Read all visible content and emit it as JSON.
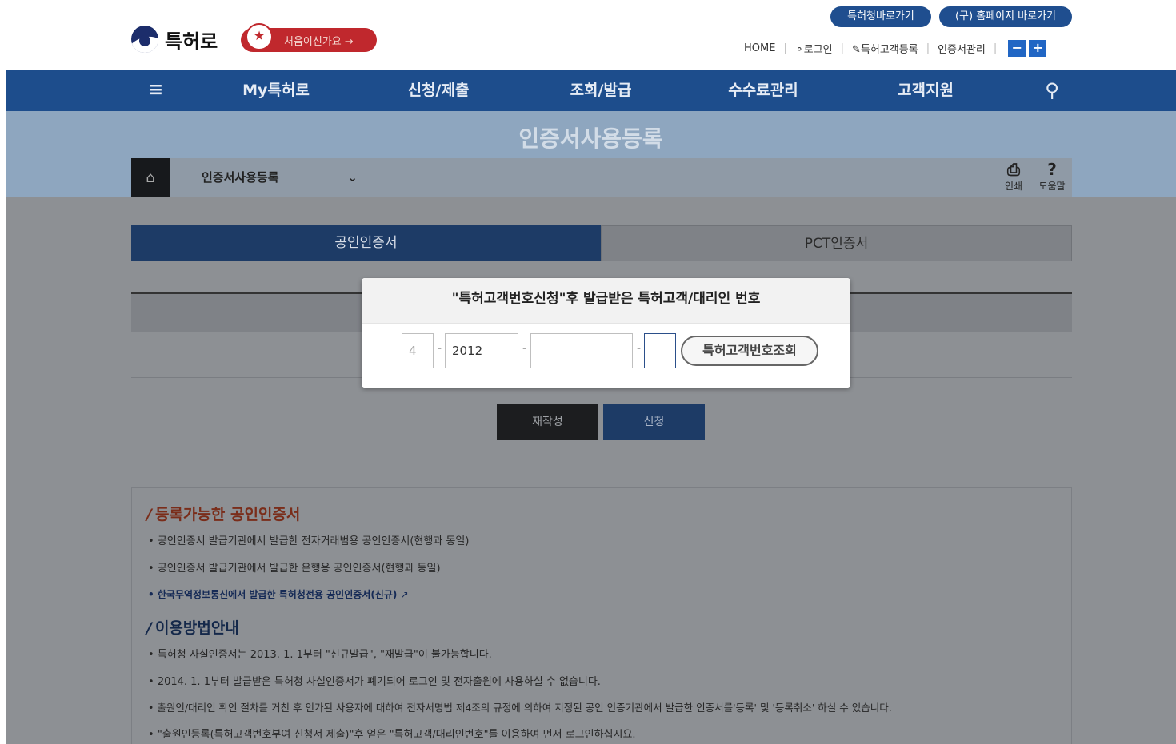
{
  "header": {
    "logo_text": "특허로",
    "newbie_label": "처음이신가요 →",
    "quick_links": [
      "특허청바로가기",
      "(구) 홈페이지 바로가기"
    ],
    "top_nav": [
      "HOME",
      "로그인",
      "특허고객등록",
      "인증서관리"
    ],
    "zoom_out": "−",
    "zoom_in": "+"
  },
  "main_nav": [
    "My특허로",
    "신청/제출",
    "조회/발급",
    "수수료관리",
    "고객지원"
  ],
  "banner": {
    "title": "인증서사용등록"
  },
  "breadcrumb": {
    "selected": "인증서사용등록",
    "print_label": "인쇄",
    "help_label": "도움말",
    "help_icon": "?"
  },
  "tabs": [
    "공인인증서",
    "PCT인증서"
  ],
  "buttons": {
    "reset": "재작성",
    "apply": "신청"
  },
  "modal": {
    "title": "\"특허고객번호신청\"후 발급받은 특허고객/대리인 번호",
    "field1_placeholder": "4",
    "field2_value": "2012",
    "field3_value": "",
    "field4_value": "",
    "dash": "-",
    "lookup_button": "특허고객번호조회"
  },
  "info": {
    "section1_title": "등록가능한 공인인증서",
    "section1_items": [
      "공인인증서 발급기관에서 발급한 전자거래범용 공인인증서(현행과 동일)",
      "공인인증서 발급기관에서 발급한 은행용 공인인증서(현행과 동일)",
      "한국무역정보통신에서 발급한 특허청전용 공인인증서(신규)"
    ],
    "section2_title": "이용방법안내",
    "section2_items": [
      "특허청 사설인증서는 2013. 1. 1부터 \"신규발급\", \"재발급\"이 불가능합니다.",
      "2014. 1. 1부터 발급받은 특허청 사설인증서가 폐기되어 로그인 및 전자출원에 사용하실 수 없습니다.",
      "출원인/대리인 확인 절차를 거친 후 인가된 사용자에 대하여 전자서명법 제4조의 규정에 의하여 지정된 공인 인증기관에서 발급한 인증서를'등록' 및 '등록취소' 하실 수 있습니다.",
      "\"출원인등록(특허고객번호부여 신청서 제출)\"후 얻은 \"특허고객/대리인번호\"를 이용하여 먼저 로그인하십시요."
    ]
  }
}
